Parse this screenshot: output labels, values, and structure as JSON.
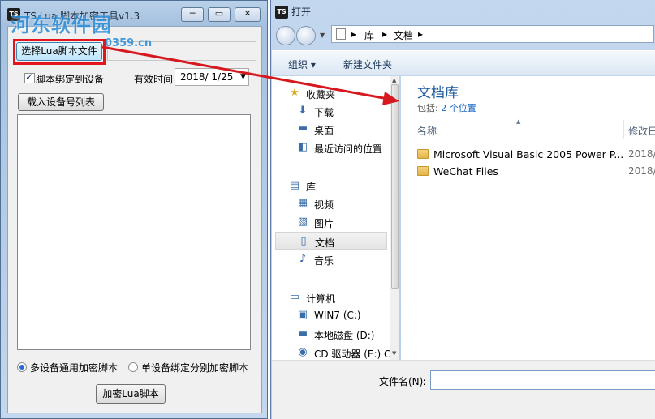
{
  "left_window": {
    "title": "TS Lua 脚本加密工具v1.3",
    "watermark": "河东软件园",
    "watermark_url": "0359.cn",
    "app_icon": "TS",
    "caption_buttons": [
      "─",
      "▭",
      "✕"
    ],
    "select_button_label": "选择Lua脚本文件",
    "path_value": "",
    "bind_checkbox_label": "脚本绑定到设备",
    "bind_checked": true,
    "valid_time_label": "有效时间",
    "valid_date": "2018/  1/25",
    "load_button_label": "载入设备号列表",
    "radio_multi_label": "多设备通用加密脚本",
    "radio_single_label": "单设备绑定分别加密脚本",
    "selected_mode": "multi",
    "encrypt_button_label": "加密Lua脚本",
    "highlight_color": "#e3141b"
  },
  "dialog": {
    "title": "打开",
    "app_icon": "TS",
    "breadcrumb": [
      "库",
      "文档"
    ],
    "toolbar": {
      "organize": "组织 ▾",
      "new_folder": "新建文件夹"
    },
    "nav": [
      {
        "label": "收藏夹",
        "icon": "star-icon",
        "glyph": "★",
        "kind": "group"
      },
      {
        "label": "下载",
        "icon": "download-folder-icon",
        "glyph": "⬇",
        "kind": "sub"
      },
      {
        "label": "桌面",
        "icon": "desktop-icon",
        "glyph": "▬",
        "kind": "sub"
      },
      {
        "label": "最近访问的位置",
        "icon": "recent-places-icon",
        "glyph": "◧",
        "kind": "sub"
      },
      {
        "label": "库",
        "icon": "library-icon",
        "glyph": "▤",
        "kind": "group"
      },
      {
        "label": "视频",
        "icon": "video-icon",
        "glyph": "▦",
        "kind": "sub"
      },
      {
        "label": "图片",
        "icon": "pictures-icon",
        "glyph": "▧",
        "kind": "sub"
      },
      {
        "label": "文档",
        "icon": "documents-icon",
        "glyph": "▯",
        "kind": "sub",
        "selected": true
      },
      {
        "label": "音乐",
        "icon": "music-icon",
        "glyph": "♪",
        "kind": "sub"
      },
      {
        "label": "计算机",
        "icon": "computer-icon",
        "glyph": "▭",
        "kind": "group"
      },
      {
        "label": "WIN7 (C:)",
        "icon": "drive-c-icon",
        "glyph": "▣",
        "kind": "sub"
      },
      {
        "label": "本地磁盘 (D:)",
        "icon": "drive-d-icon",
        "glyph": "▬",
        "kind": "sub"
      },
      {
        "label": "CD 驱动器 (E:) C",
        "icon": "cd-drive-icon",
        "glyph": "◉",
        "kind": "sub"
      }
    ],
    "library_title": "文档库",
    "library_includes_prefix": "包括: ",
    "library_includes_link": "2 个位置",
    "columns": {
      "name": "名称",
      "date": "修改日"
    },
    "files": [
      {
        "name": "Microsoft Visual Basic 2005 Power P...",
        "date": "2018/"
      },
      {
        "name": "WeChat Files",
        "date": "2018/"
      }
    ],
    "filename_label": "文件名(N):",
    "filename_value": ""
  }
}
